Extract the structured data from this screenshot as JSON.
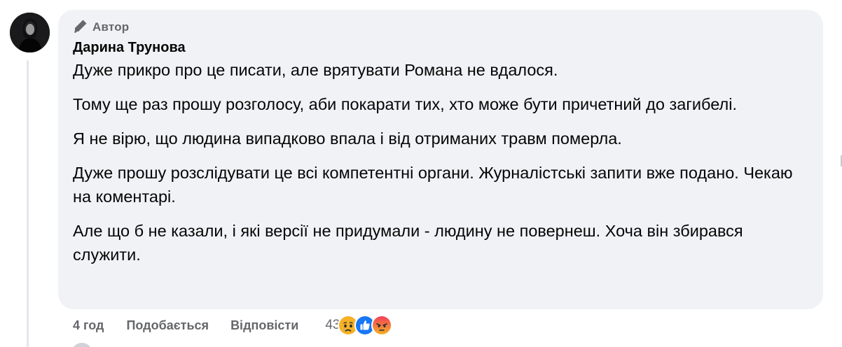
{
  "comment": {
    "badge_label": "Автор",
    "author_name": "Дарина Трунова",
    "paragraphs": [
      "Дуже прикро про це писати, але врятувати Романа не вдалося.",
      "Тому ще раз прошу розголосу, аби покарати тих, хто може бути причетний до загибелі.",
      "Я не вірю, що людина випадково впала і від отриманих травм померла.",
      "Дуже прошу розслідувати це всі компетентні органи. Журналістські запити вже подано. Чекаю на коментарі.",
      "Але що б не казали, і які версії не придумали - людину не повернеш. Хоча він збирався служити."
    ]
  },
  "actions": {
    "time": "4 год",
    "like_label": "Подобається",
    "reply_label": "Відповісти",
    "reaction_count": "43",
    "reaction_icons": [
      "sad-reaction-icon",
      "like-reaction-icon",
      "angry-reaction-icon"
    ]
  },
  "colors": {
    "bubble_bg": "#f0f2f5",
    "secondary_text": "#65676b",
    "like_blue": "#1877f2",
    "angry_red": "#f33e58",
    "sad_yellow": "#f7b125"
  }
}
